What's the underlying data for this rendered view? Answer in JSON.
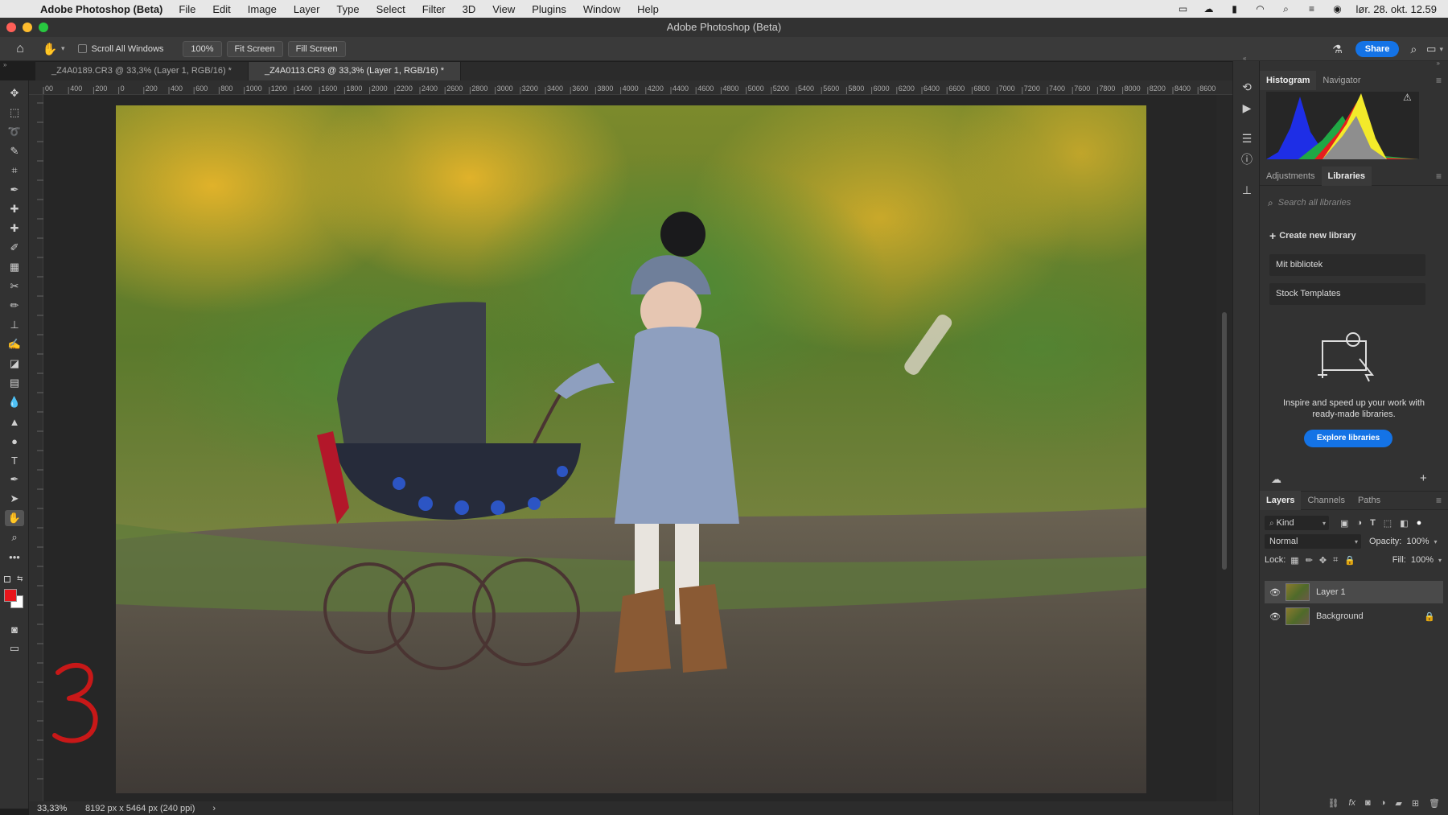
{
  "menubar": {
    "app_name": "Adobe Photoshop (Beta)",
    "items": [
      "File",
      "Edit",
      "Image",
      "Layer",
      "Type",
      "Select",
      "Filter",
      "3D",
      "View",
      "Plugins",
      "Window",
      "Help"
    ],
    "clock": "lør. 28. okt. 12.59"
  },
  "window": {
    "title": "Adobe Photoshop (Beta)"
  },
  "options": {
    "scroll_all_windows": "Scroll All Windows",
    "zoom": "100%",
    "fit_screen": "Fit Screen",
    "fill_screen": "Fill Screen",
    "share": "Share"
  },
  "tabs": [
    {
      "label": "_Z4A0189.CR3 @ 33,3% (Layer 1, RGB/16) *"
    },
    {
      "label": "_Z4A0113.CR3 @ 33,3% (Layer 1, RGB/16) *"
    }
  ],
  "ruler": {
    "labels": [
      "00",
      "400",
      "200",
      "0",
      "200",
      "400",
      "600",
      "800",
      "1000",
      "1200",
      "1400",
      "1600",
      "1800",
      "2000",
      "2200",
      "2400",
      "2600",
      "2800",
      "3000",
      "3200",
      "3400",
      "3600",
      "3800",
      "4000",
      "4200",
      "4400",
      "4600",
      "4800",
      "5000",
      "5200",
      "5400",
      "5600",
      "5800",
      "6000",
      "6200",
      "6400",
      "6600",
      "6800",
      "7000",
      "7200",
      "7400",
      "7600",
      "7800",
      "8000",
      "8200",
      "8400",
      "8600"
    ]
  },
  "status": {
    "zoom": "33,33%",
    "doc_info": "8192 px x 5464 px (240 ppi)",
    "arrow": "›"
  },
  "annotation": {
    "text": "3"
  },
  "histogram_panel": {
    "tabs": [
      "Histogram",
      "Navigator"
    ]
  },
  "libraries_panel": {
    "tabs": [
      "Adjustments",
      "Libraries"
    ],
    "search_placeholder": "Search all libraries",
    "create_new": "Create new library",
    "libraries": [
      "Mit bibliotek",
      "Stock Templates"
    ],
    "promo_text": "Inspire and speed up your work with ready-made libraries.",
    "explore_button": "Explore libraries"
  },
  "layers_panel": {
    "tabs": [
      "Layers",
      "Channels",
      "Paths"
    ],
    "filter_kind": "Kind",
    "blend_mode": "Normal",
    "opacity_label": "Opacity:",
    "opacity_value": "100%",
    "lock_label": "Lock:",
    "fill_label": "Fill:",
    "fill_value": "100%",
    "layers": [
      {
        "name": "Layer 1",
        "selected": true
      },
      {
        "name": "Background",
        "locked": true
      }
    ]
  },
  "colors": {
    "foreground": "#e8151b",
    "background": "#ffffff",
    "accent": "#1473e6"
  }
}
